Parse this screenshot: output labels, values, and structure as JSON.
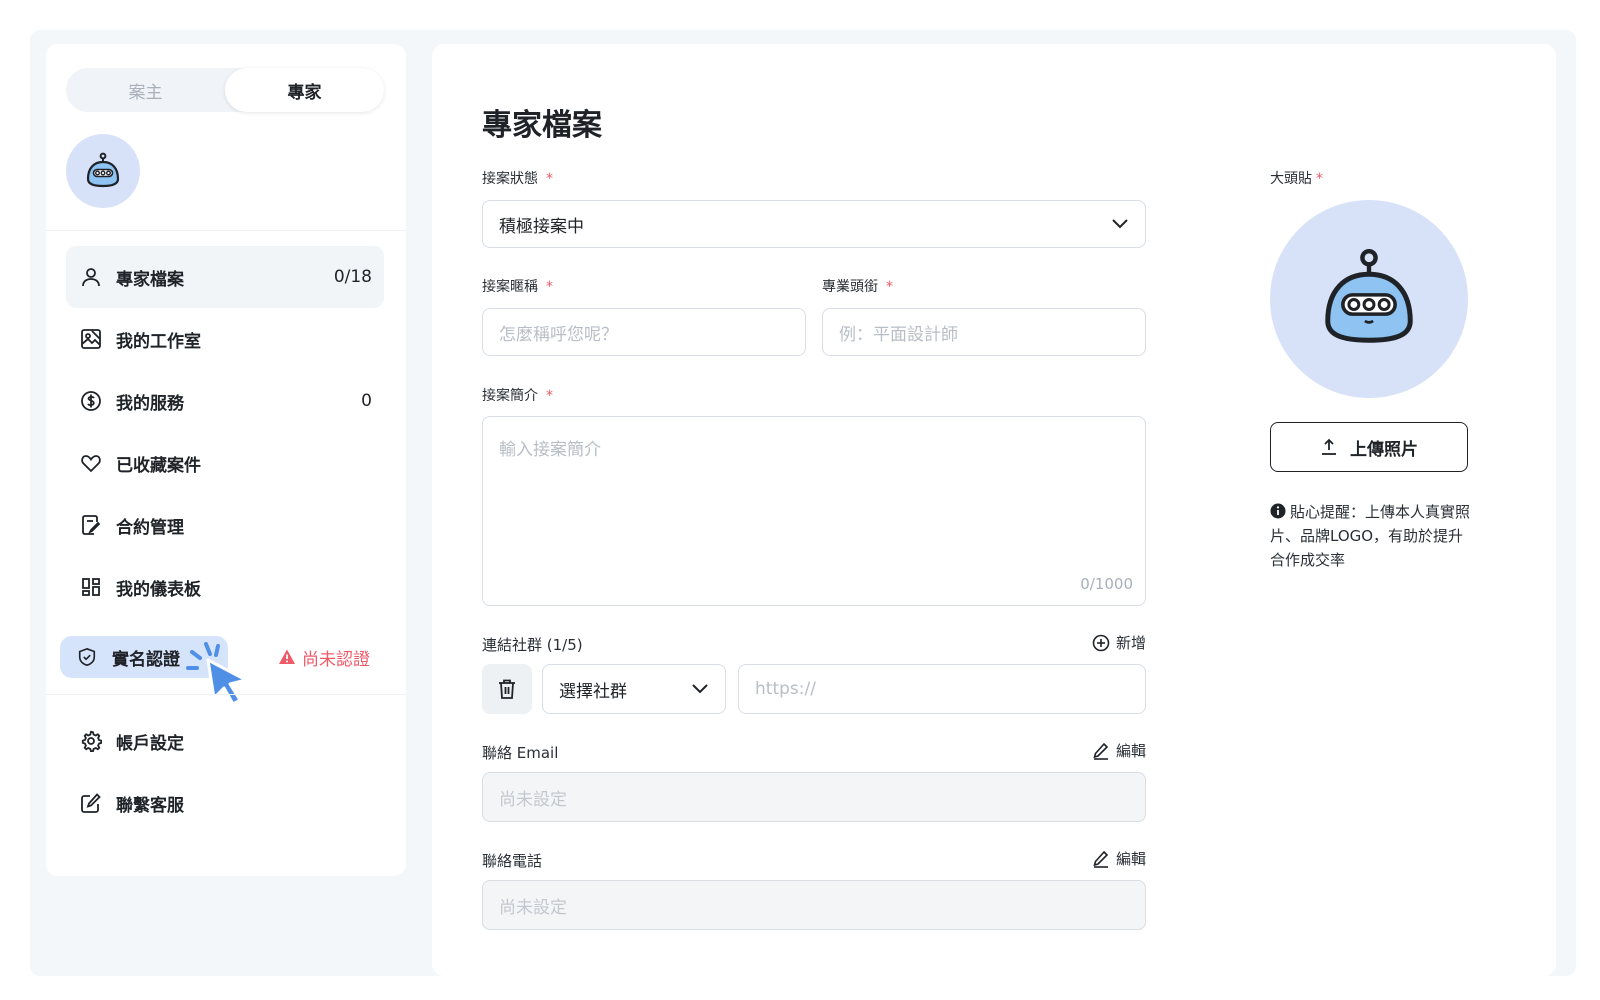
{
  "sidebar": {
    "role_toggle": {
      "client": "案主",
      "expert": "專家",
      "selected": "expert"
    },
    "nav": [
      {
        "label": "專家檔案",
        "count": "0/18",
        "icon": "user-icon",
        "active": true
      },
      {
        "label": "我的工作室",
        "count": "",
        "icon": "studio-image-icon"
      },
      {
        "label": "我的服務",
        "count": "0",
        "icon": "dollar-circle-icon"
      },
      {
        "label": "已收藏案件",
        "count": "",
        "icon": "heart-icon"
      },
      {
        "label": "合約管理",
        "count": "",
        "icon": "contract-sign-icon"
      },
      {
        "label": "我的儀表板",
        "count": "",
        "icon": "dashboard-grid-icon"
      }
    ],
    "verify": {
      "label": "實名認證",
      "status": "尚未認證",
      "icon": "shield-check-icon"
    },
    "bottom_nav": [
      {
        "label": "帳戶設定",
        "icon": "gear-icon"
      },
      {
        "label": "聯繫客服",
        "icon": "edit-square-icon"
      }
    ]
  },
  "main": {
    "title": "專家檔案",
    "status": {
      "label": "接案狀態",
      "required": "*",
      "value": "積極接案中"
    },
    "nickname": {
      "label": "接案暱稱",
      "required": "*",
      "placeholder": "怎麼稱呼您呢？"
    },
    "job_title": {
      "label": "專業頭銜",
      "required": "*",
      "placeholder": "例：平面設計師"
    },
    "intro": {
      "label": "接案簡介",
      "required": "*",
      "placeholder": "輸入接案簡介",
      "counter": "0/1000"
    },
    "social": {
      "label": "連結社群 (1/5)",
      "add_label": "新增",
      "select_value": "選擇社群",
      "url_placeholder": "https://"
    },
    "email": {
      "label": "聯絡 Email",
      "edit_label": "編輯",
      "placeholder": "尚未設定"
    },
    "phone": {
      "label": "聯絡電話",
      "edit_label": "編輯",
      "placeholder": "尚未設定"
    },
    "avatar": {
      "label": "大頭貼",
      "required": "*",
      "upload_label": "上傳照片",
      "tip": "貼心提醒：上傳本人真實照片、品牌LOGO，有助於提升合作成交率"
    }
  },
  "colors": {
    "accent_light": "#d6e4fb",
    "avatar_bg": "#d7e2f9",
    "warning": "#ef5a68",
    "cursor": "#4f8fe6"
  }
}
